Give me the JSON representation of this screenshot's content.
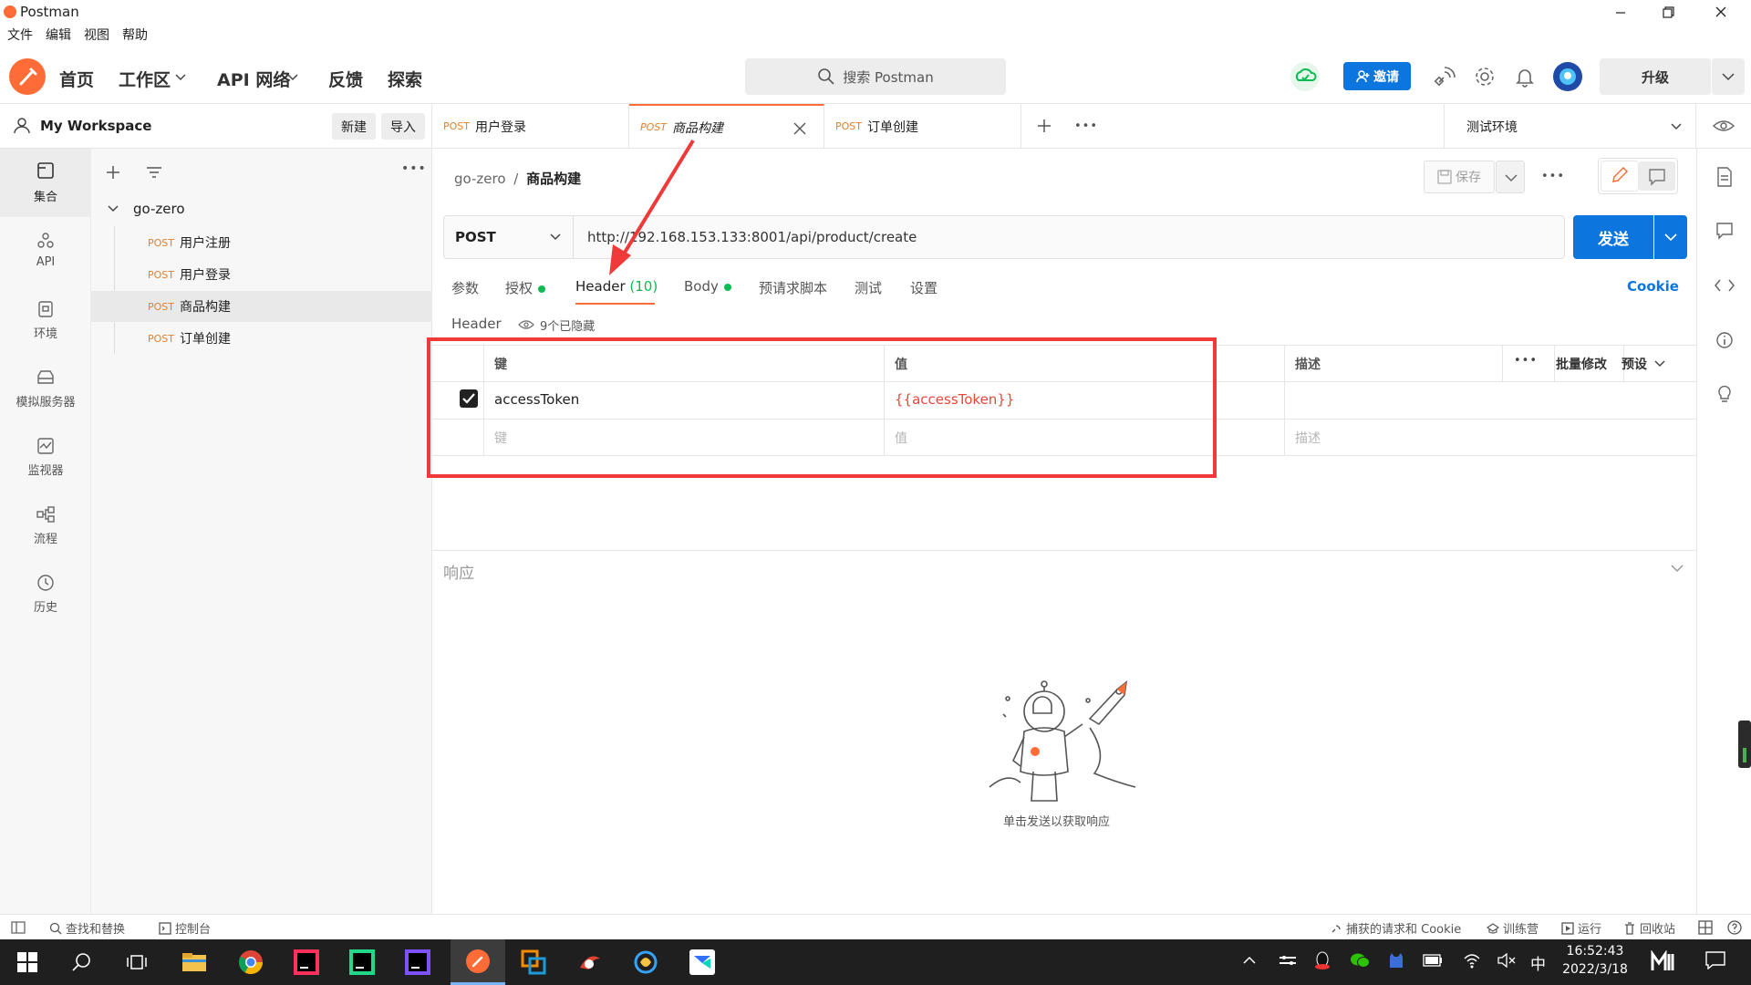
{
  "app": {
    "title": "Postman"
  },
  "menu": [
    "文件",
    "编辑",
    "视图",
    "帮助"
  ],
  "nav": {
    "home": "首页",
    "workspace": "工作区",
    "api_network": "API 网络",
    "feedback": "反馈",
    "explore": "探索",
    "search_placeholder": "搜索 Postman",
    "invite": "邀请",
    "upgrade": "升级"
  },
  "workspace": {
    "name": "My Workspace",
    "new_label": "新建",
    "import_label": "导入"
  },
  "sidebar_nav": [
    "集合",
    "API",
    "环境",
    "模拟服务器",
    "监视器",
    "流程",
    "历史"
  ],
  "collection": {
    "name": "go-zero",
    "requests": [
      {
        "method": "POST",
        "name": "用户注册"
      },
      {
        "method": "POST",
        "name": "用户登录"
      },
      {
        "method": "POST",
        "name": "商品构建"
      },
      {
        "method": "POST",
        "name": "订单创建"
      }
    ]
  },
  "tabs": [
    {
      "method": "POST",
      "name": "用户登录"
    },
    {
      "method": "POST",
      "name": "商品构建"
    },
    {
      "method": "POST",
      "name": "订单创建"
    }
  ],
  "environment": "测试环境",
  "breadcrumb": {
    "parent": "go-zero",
    "separator": "/",
    "current": "商品构建"
  },
  "save_label": "保存",
  "request": {
    "method": "POST",
    "url": "http://192.168.153.133:8001/api/product/create",
    "send_label": "发送"
  },
  "request_tabs": {
    "params": "参数",
    "auth": "授权",
    "header": "Header",
    "header_count": "(10)",
    "body": "Body",
    "prerequest": "预请求脚本",
    "tests": "测试",
    "settings": "设置",
    "cookie": "Cookie"
  },
  "header_section": {
    "title": "Header",
    "hidden": "9个已隐藏"
  },
  "header_table": {
    "columns": {
      "key": "键",
      "value": "值",
      "desc": "描述",
      "bulk_edit": "批量修改",
      "preset": "预设"
    },
    "rows": [
      {
        "checked": true,
        "key": "accessToken",
        "value": "{{accessToken}}",
        "desc": ""
      }
    ],
    "placeholders": {
      "key": "键",
      "value": "值",
      "desc": "描述"
    }
  },
  "response": {
    "title": "响应",
    "empty_hint": "单击发送以获取响应"
  },
  "statusbar": {
    "find_replace": "查找和替换",
    "console": "控制台",
    "capture": "捕获的请求和 Cookie",
    "bootcamp": "训练营",
    "runner": "运行",
    "trash": "回收站"
  },
  "clock": {
    "time": "16:52:43",
    "date": "2022/3/18"
  },
  "tray": {
    "ime": "中"
  },
  "colors": {
    "accent": "#ff6c37",
    "send": "#0d76de",
    "annotation": "#f03a3a",
    "success": "#0cbb52"
  }
}
